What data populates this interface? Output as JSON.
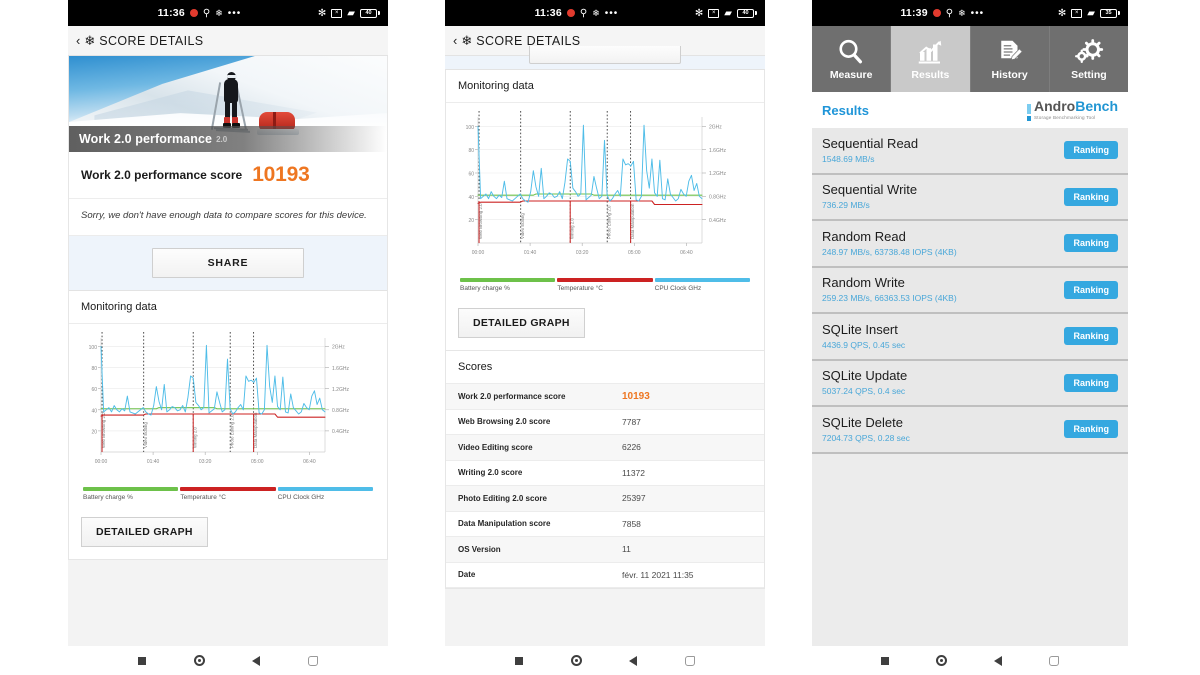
{
  "phones": [
    {
      "id": "phone-pcmark-summary",
      "statusbar": {
        "time": "11:36",
        "icons": [
          "record-icon",
          "location-icon",
          "snowflake-icon",
          "more-icon"
        ],
        "right_icons": [
          "bluetooth-icon",
          "mute-icon",
          "wifi-icon",
          "battery-icon"
        ],
        "battery_level": "40"
      },
      "appbar": {
        "back": "‹",
        "flake": "❄",
        "title": "SCORE DETAILS"
      },
      "hero": {
        "caption": "Work 2.0 performance",
        "caption_sub": "2.0"
      },
      "score": {
        "label": "Work 2.0 performance score",
        "value": "10193",
        "color": "#ee7621"
      },
      "note": "Sorry, we don't have enough data to compare scores for this device.",
      "share_button": "SHARE",
      "monitoring_title": "Monitoring data",
      "detailed_graph_button": "DETAILED GRAPH"
    },
    {
      "id": "phone-pcmark-scores",
      "statusbar": {
        "time": "11:36",
        "battery_level": "40"
      },
      "appbar": {
        "back": "‹",
        "flake": "❄",
        "title": "SCORE DETAILS"
      },
      "monitoring_title": "Monitoring data",
      "detailed_graph_button": "DETAILED GRAPH",
      "scores_title": "Scores",
      "scores_rows": [
        {
          "key": "Work 2.0 performance score",
          "value": "10193",
          "highlight": true
        },
        {
          "key": "Web Browsing 2.0 score",
          "value": "7787",
          "highlight": false
        },
        {
          "key": "Video Editing score",
          "value": "6226",
          "highlight": false
        },
        {
          "key": "Writing 2.0 score",
          "value": "11372",
          "highlight": false
        },
        {
          "key": "Photo Editing 2.0 score",
          "value": "25397",
          "highlight": false
        },
        {
          "key": "Data Manipulation score",
          "value": "7858",
          "highlight": false
        },
        {
          "key": "OS Version",
          "value": "11",
          "highlight": false
        },
        {
          "key": "Date",
          "value": "févr. 11 2021 11:35",
          "highlight": false
        }
      ]
    },
    {
      "id": "phone-androbench",
      "statusbar": {
        "time": "11:39",
        "battery_level": "35"
      },
      "tabs": [
        {
          "label": "Measure",
          "icon": "magnifier-icon",
          "active": false
        },
        {
          "label": "Results",
          "icon": "bar-chart-icon",
          "active": true
        },
        {
          "label": "History",
          "icon": "document-icon",
          "active": false
        },
        {
          "label": "Setting",
          "icon": "gear-icon",
          "active": false
        }
      ],
      "header": {
        "title": "Results",
        "logo_main": "Andro",
        "logo_accent": "Bench",
        "logo_sub": "Storage Benchmarking Tool"
      },
      "ranking_label": "Ranking",
      "results": [
        {
          "name": "Sequential Read",
          "detail": "1548.69 MB/s"
        },
        {
          "name": "Sequential Write",
          "detail": "736.29 MB/s"
        },
        {
          "name": "Random Read",
          "detail": "248.97 MB/s, 63738.48 IOPS (4KB)"
        },
        {
          "name": "Random Write",
          "detail": "259.23 MB/s, 66363.53 IOPS (4KB)"
        },
        {
          "name": "SQLite Insert",
          "detail": "4436.9 QPS, 0.45 sec"
        },
        {
          "name": "SQLite Update",
          "detail": "5037.24 QPS, 0.4 sec"
        },
        {
          "name": "SQLite Delete",
          "detail": "7204.73 QPS, 0.28 sec"
        }
      ]
    }
  ],
  "navbar": {
    "items": [
      "recents-square-icon",
      "home-circle-icon",
      "back-triangle-icon",
      "screenshot-square-icon"
    ]
  },
  "chart_data": {
    "type": "line",
    "title": "Monitoring data",
    "xlabel": "",
    "ylabel": "",
    "xlim": [
      0,
      430
    ],
    "ylim": [
      0,
      108
    ],
    "y2lim": [
      0,
      2.16
    ],
    "grid": true,
    "legend_position": "bottom",
    "x_ticks": [
      "00:00",
      "01:40",
      "03:20",
      "05:00",
      "06:40"
    ],
    "x_tick_values": [
      0,
      100,
      200,
      300,
      400
    ],
    "y_ticks": [
      "20",
      "40",
      "60",
      "80",
      "100"
    ],
    "y_tick_values": [
      20,
      40,
      60,
      80,
      100
    ],
    "y2_ticks": [
      "0.4GHz",
      "0.8GHz",
      "1.2GHz",
      "1.6GHz",
      "2GHz"
    ],
    "y2_tick_values": [
      0.4,
      0.8,
      1.2,
      1.6,
      2.0
    ],
    "legend": [
      {
        "name": "Battery charge %",
        "color": "#6dc14a"
      },
      {
        "name": "Temperature °C",
        "color": "#cc2222"
      },
      {
        "name": "CPU Clock GHz",
        "color": "#4fbde8"
      }
    ],
    "annotations": [
      {
        "label": "Web Browsing 2.0",
        "x": 2
      },
      {
        "label": "Video Editing",
        "x": 82
      },
      {
        "label": "Writing 2.0",
        "x": 177
      },
      {
        "label": "Photo Editing 2.0",
        "x": 248
      },
      {
        "label": "Data Manipulation",
        "x": 293
      }
    ],
    "series": [
      {
        "name": "Battery charge %",
        "color": "#6dc14a",
        "values": [
          41,
          41,
          41,
          41,
          41,
          41,
          41,
          41,
          41,
          41,
          41,
          41,
          41,
          41,
          41,
          41,
          41,
          41,
          41,
          41,
          41,
          41,
          42,
          42,
          42,
          42,
          42,
          42,
          42,
          42,
          42,
          42,
          42,
          42,
          42,
          42,
          42,
          42,
          42,
          42,
          42,
          42,
          42,
          42,
          41,
          41,
          41,
          41,
          41,
          41,
          41,
          41,
          41,
          41,
          41,
          41,
          41,
          41,
          41,
          41,
          41,
          41,
          41,
          41,
          41,
          41,
          41,
          41,
          41,
          41,
          41,
          41,
          41,
          41,
          41,
          41,
          41,
          41,
          41,
          41,
          41,
          41,
          41,
          41,
          41,
          41
        ]
      },
      {
        "name": "Temperature °C",
        "color": "#cc2222",
        "values": [
          34,
          35,
          35,
          35,
          35,
          35,
          35,
          35,
          35,
          35,
          35,
          35,
          35,
          35,
          35,
          35,
          35,
          36,
          36,
          36,
          36,
          36,
          36,
          36,
          36,
          36,
          36,
          36,
          36,
          36,
          36,
          36,
          36,
          36,
          36,
          36,
          36,
          36,
          36,
          36,
          36,
          36,
          36,
          36,
          36,
          36,
          36,
          36,
          36,
          36,
          36,
          36,
          36,
          36,
          36,
          36,
          36,
          36,
          36,
          36,
          36,
          36,
          36,
          36,
          36,
          36,
          36,
          33,
          33,
          33,
          33,
          33,
          33,
          33,
          33,
          33,
          33,
          33,
          33,
          33,
          33,
          33,
          33,
          33,
          33,
          33
        ]
      },
      {
        "name": "CPU Clock GHz",
        "color": "#4fbde8",
        "values": [
          100,
          38,
          40,
          42,
          38,
          44,
          40,
          38,
          41,
          39,
          53,
          38,
          37,
          36,
          38,
          40,
          42,
          38,
          36,
          35,
          44,
          62,
          48,
          40,
          64,
          38,
          40,
          43,
          42,
          39,
          40,
          44,
          38,
          52,
          72,
          70,
          47,
          44,
          40,
          42,
          101,
          37,
          39,
          41,
          57,
          47,
          38,
          40,
          88,
          41,
          36,
          38,
          42,
          45,
          40,
          72,
          67,
          68,
          66,
          70,
          37,
          36,
          40,
          101,
          62,
          47,
          72,
          43,
          40,
          71,
          38,
          37,
          55,
          42,
          39,
          36,
          38,
          46,
          42,
          40,
          53,
          58,
          45,
          51,
          40,
          38
        ]
      }
    ]
  }
}
